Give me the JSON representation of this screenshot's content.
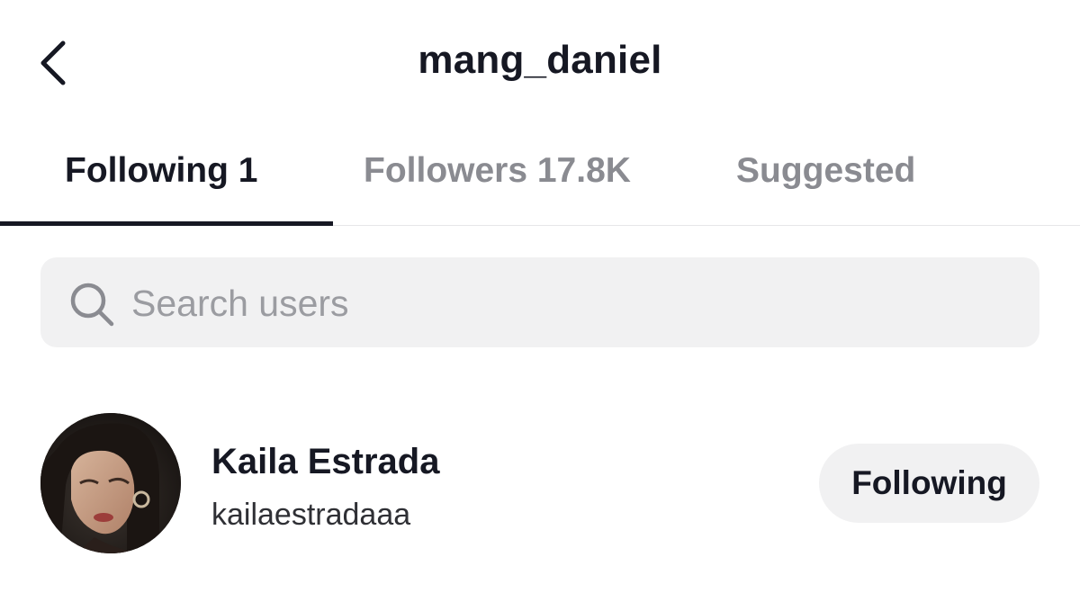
{
  "header": {
    "title": "mang_daniel",
    "back_icon": "chevron-left-icon"
  },
  "tabs": [
    {
      "label": "Following 1",
      "active": true
    },
    {
      "label": "Followers 17.8K",
      "active": false
    },
    {
      "label": "Suggested",
      "active": false
    }
  ],
  "search": {
    "placeholder": "Search users",
    "value": "",
    "icon": "search-icon"
  },
  "users": [
    {
      "display_name": "Kaila Estrada",
      "username": "kailaestradaaa",
      "button_label": "Following"
    }
  ],
  "colors": {
    "text_primary": "#161823",
    "text_inactive": "#8a8b91",
    "surface_grey": "#f1f1f2"
  }
}
